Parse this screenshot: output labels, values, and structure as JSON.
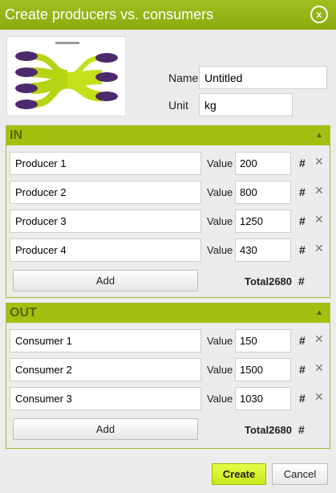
{
  "dialog": {
    "title": "Create producers vs. consumers",
    "close_label": "x",
    "colors": {
      "accent": "#a4bf10",
      "header_text": "#5a6800",
      "button": "#d6f02a"
    }
  },
  "meta": {
    "name_label": "Name",
    "name_value": "Untitled",
    "unit_label": "Unit",
    "unit_value": "kg"
  },
  "in_section": {
    "title": "IN",
    "rows": [
      {
        "name": "Producer 1",
        "value_label": "Value",
        "value": "200",
        "hash": "#"
      },
      {
        "name": "Producer 2",
        "value_label": "Value",
        "value": "800",
        "hash": "#"
      },
      {
        "name": "Producer 3",
        "value_label": "Value",
        "value": "1250",
        "hash": "#"
      },
      {
        "name": "Producer 4",
        "value_label": "Value",
        "value": "430",
        "hash": "#"
      }
    ],
    "add_label": "Add",
    "total_text": "Total2680",
    "total_hash": "#"
  },
  "out_section": {
    "title": "OUT",
    "rows": [
      {
        "name": "Consumer 1",
        "value_label": "Value",
        "value": "150",
        "hash": "#"
      },
      {
        "name": "Consumer 2",
        "value_label": "Value",
        "value": "1500",
        "hash": "#"
      },
      {
        "name": "Consumer 3",
        "value_label": "Value",
        "value": "1030",
        "hash": "#"
      }
    ],
    "add_label": "Add",
    "total_text": "Total2680",
    "total_hash": "#"
  },
  "footer": {
    "create_label": "Create",
    "cancel_label": "Cancel"
  },
  "icons": {
    "collapse": "chevron-up-icon",
    "delete": "delete-x-icon",
    "close": "close-icon"
  }
}
